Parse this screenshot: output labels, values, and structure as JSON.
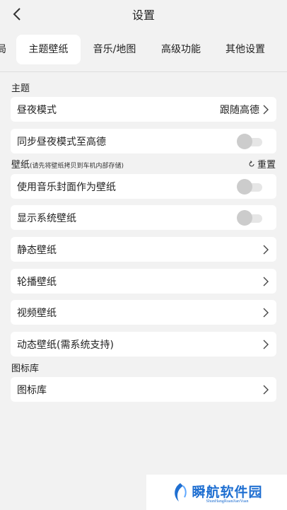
{
  "header": {
    "title": "设置"
  },
  "tabs": [
    {
      "label": "局",
      "active": false
    },
    {
      "label": "主题壁纸",
      "active": true
    },
    {
      "label": "音乐/地图",
      "active": false
    },
    {
      "label": "高级功能",
      "active": false
    },
    {
      "label": "其他设置",
      "active": false
    }
  ],
  "theme_section": {
    "label": "主题",
    "day_night": {
      "label": "昼夜模式",
      "value": "跟随高德"
    },
    "sync": {
      "label": "同步昼夜模式至高德",
      "on": false
    }
  },
  "wallpaper_section": {
    "label": "壁纸",
    "hint": "(请先将壁纸拷贝到车机内部存储)",
    "reset": "重置",
    "items": {
      "music_cover": {
        "label": "使用音乐封面作为壁纸",
        "on": false
      },
      "system_wallpaper": {
        "label": "显示系统壁纸",
        "on": false
      },
      "static": {
        "label": "静态壁纸"
      },
      "carousel": {
        "label": "轮播壁纸"
      },
      "video": {
        "label": "视频壁纸"
      },
      "dynamic": {
        "label": "动态壁纸(需系统支持)"
      }
    }
  },
  "icon_section": {
    "label": "图标库",
    "item": {
      "label": "图标库"
    }
  },
  "watermark": {
    "main": "瞬航软件园",
    "sub": "ShunHangRuanJianYuan"
  },
  "colors": {
    "background": "#f2f2f2",
    "card": "#ffffff",
    "toggle_off": "#cccccc",
    "watermark": "#1f6fd1"
  }
}
